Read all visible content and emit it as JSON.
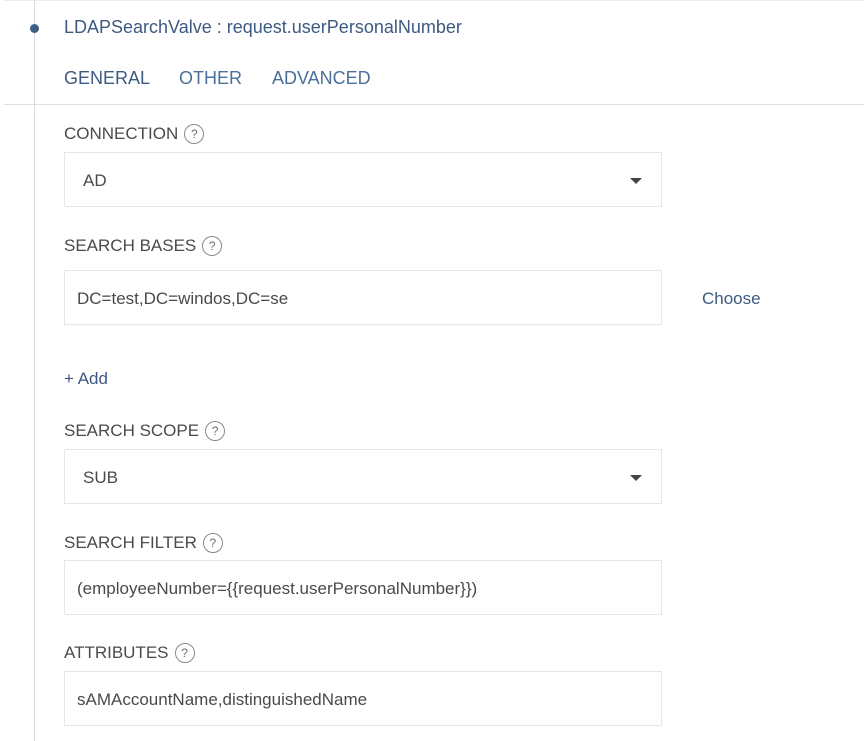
{
  "valve": {
    "title": "LDAPSearchValve : request.userPersonalNumber"
  },
  "tabs": [
    {
      "label": "GENERAL",
      "active": true
    },
    {
      "label": "OTHER",
      "active": false
    },
    {
      "label": "ADVANCED",
      "active": false
    }
  ],
  "help_glyph": "?",
  "connection": {
    "label": "CONNECTION",
    "value": "AD"
  },
  "search_bases": {
    "label": "SEARCH BASES",
    "value": "DC=test,DC=windos,DC=se",
    "choose_label": "Choose",
    "add_label": "+ Add"
  },
  "search_scope": {
    "label": "SEARCH SCOPE",
    "value": "SUB"
  },
  "search_filter": {
    "label": "SEARCH FILTER",
    "value": "(employeeNumber={{request.userPersonalNumber}})"
  },
  "attributes": {
    "label": "ATTRIBUTES",
    "value": "sAMAccountName,distinguishedName"
  },
  "colors": {
    "accent": "#3d5a80",
    "tab": "#4b6f99",
    "text": "#4a4a4a",
    "border": "#e4e6e9"
  }
}
